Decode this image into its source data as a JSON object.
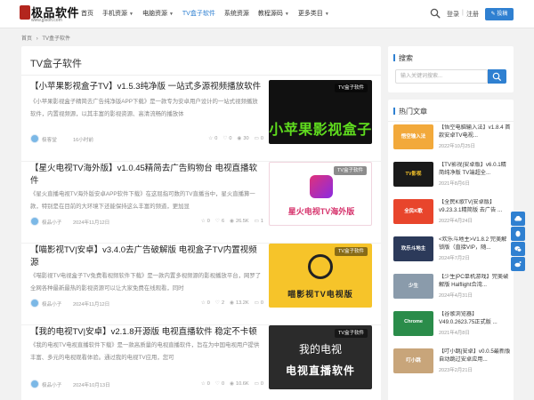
{
  "site": {
    "logo_text": "极品软件",
    "logo_url": "www.jpsoft.com"
  },
  "nav": [
    {
      "label": "首页",
      "caret": false
    },
    {
      "label": "手机资源",
      "caret": true
    },
    {
      "label": "电脑资源",
      "caret": true
    },
    {
      "label": "TV盒子软件",
      "caret": false
    },
    {
      "label": "系统资源",
      "caret": false
    },
    {
      "label": "教程源码",
      "caret": true
    },
    {
      "label": "更多类目",
      "caret": true
    }
  ],
  "header": {
    "login": "登录",
    "separator": "|",
    "register": "注册",
    "post_button": "投稿"
  },
  "breadcrumb": [
    "首页",
    "›",
    "TV盒子软件"
  ],
  "page_title": "TV盒子软件",
  "articles": [
    {
      "title": "【小苹果影视盒子TV】v1.5.3纯净版 一站式多源视频播放软件",
      "excerpt": "《小苹果影视盒子精简去广告纯净版APP下载》是一款专为安卓用户设计的一站式视频播放软件，内置视频源，以其丰富的影视资源、高清流畅的播放体",
      "author": "极客堂",
      "date": "16小时前",
      "stats": [
        "0",
        "0",
        "30",
        "0"
      ],
      "thumb_tag": "TV盒子软件",
      "thumb_text": "小苹果影视盒子",
      "thumb_bg": "#111111",
      "thumb_color": "#5fdc1e"
    },
    {
      "title": "【星火电视TV海外版】v1.0.45精简去广告购物台 电视直播软件",
      "excerpt": "《星火直播电视TV海外版安卓APP软件下载》在这屈指可数的TV直播当中，星火直播算一款，特别是在目前的大环境下还能保持这么丰富的频道，更加显",
      "author": "极品小子",
      "date": "2024年11月12日",
      "stats": [
        "0",
        "6",
        "26.5K",
        "1"
      ],
      "thumb_tag": "TV盒子软件",
      "thumb_text": "星火电视TV海外版",
      "thumb_bg": "#ffffff",
      "thumb_color": "#d6336c"
    },
    {
      "title": "【喵影视TV|安卓】v3.4.0去广告破解版 电视盒子TV内置视频源",
      "excerpt": "《喵影视TV电视盒子TV免费看视频软件下载》是一款内置多视频源的影视播放平台，网罗了全网各种最新最热的影视资源可以让大家免费在线观看，同时",
      "author": "极品小子",
      "date": "2024年11月12日",
      "stats": [
        "0",
        "2",
        "13.2K",
        "0"
      ],
      "thumb_tag": "TV盒子软件",
      "thumb_text": "喵影视TV电视版",
      "thumb_bg": "#f6c42a",
      "thumb_color": "#222222"
    },
    {
      "title": "【我的电视TV|安卓】v2.1.8开源版 电视直播软件 稳定不卡顿",
      "excerpt": "《我的电视TV电视直播软件下载》是一款高质量的电视直播软件，旨在为中国电视用户提供丰富、多元的电视观看体验。通过我的电视TV应用，您可",
      "author": "极品小子",
      "date": "2024年10月13日",
      "stats": [
        "0",
        "0",
        "10.6K",
        "0"
      ],
      "thumb_tag": "TV盒子软件",
      "thumb_text": "我的电视",
      "thumb_text2": "电视直播软件",
      "thumb_bg": "#2b2b2b",
      "thumb_color": "#ffffff"
    }
  ],
  "sidebar": {
    "search": {
      "title": "搜索",
      "placeholder": "输入关键词搜索..."
    },
    "hot": {
      "title": "热门文章",
      "items": [
        {
          "title": "【悟空电脑输入法】v1.8.4 首款安卓TV电视...",
          "date": "2022年10月25日",
          "thumb_text": "悟空输入法",
          "bg": "#f2a93b"
        },
        {
          "title": "【TV影视|安卓版】v6.0.1精简纯净版 TV端超全...",
          "date": "2021年8月6日",
          "thumb_text": "TV影视",
          "bg": "#1a1a1a"
        },
        {
          "title": "【全民K歌TV|安卓版】v9.23.3.1精简版 去广告 ...",
          "date": "2022年4月24日",
          "thumb_text": "全民K歌",
          "bg": "#e8452c"
        },
        {
          "title": "<欢乐斗地主>V1.8.2 完美解锁版（直接VIP，随...",
          "date": "2024年7月2日",
          "thumb_text": "欢乐斗地主",
          "bg": "#2c3a5a"
        },
        {
          "title": "【少生|PC单机游戏】完美破解版 Halflight合湾...",
          "date": "2024年4月31日",
          "thumb_text": "少生",
          "bg": "#8a9bab"
        },
        {
          "title": "【谷歌浏览器】V49.0.2623.75正式版 ...",
          "date": "2021年4月8日",
          "thumb_text": "Chrome",
          "bg": "#2a8c4a"
        },
        {
          "title": "【叮小跳|安卓】v0.0.5最新版 自动跳过安卓应用...",
          "date": "2023年2月21日",
          "thumb_text": "叮小跳",
          "bg": "#c8a57a"
        }
      ]
    }
  },
  "colors": {
    "accent": "#2f80d1"
  }
}
